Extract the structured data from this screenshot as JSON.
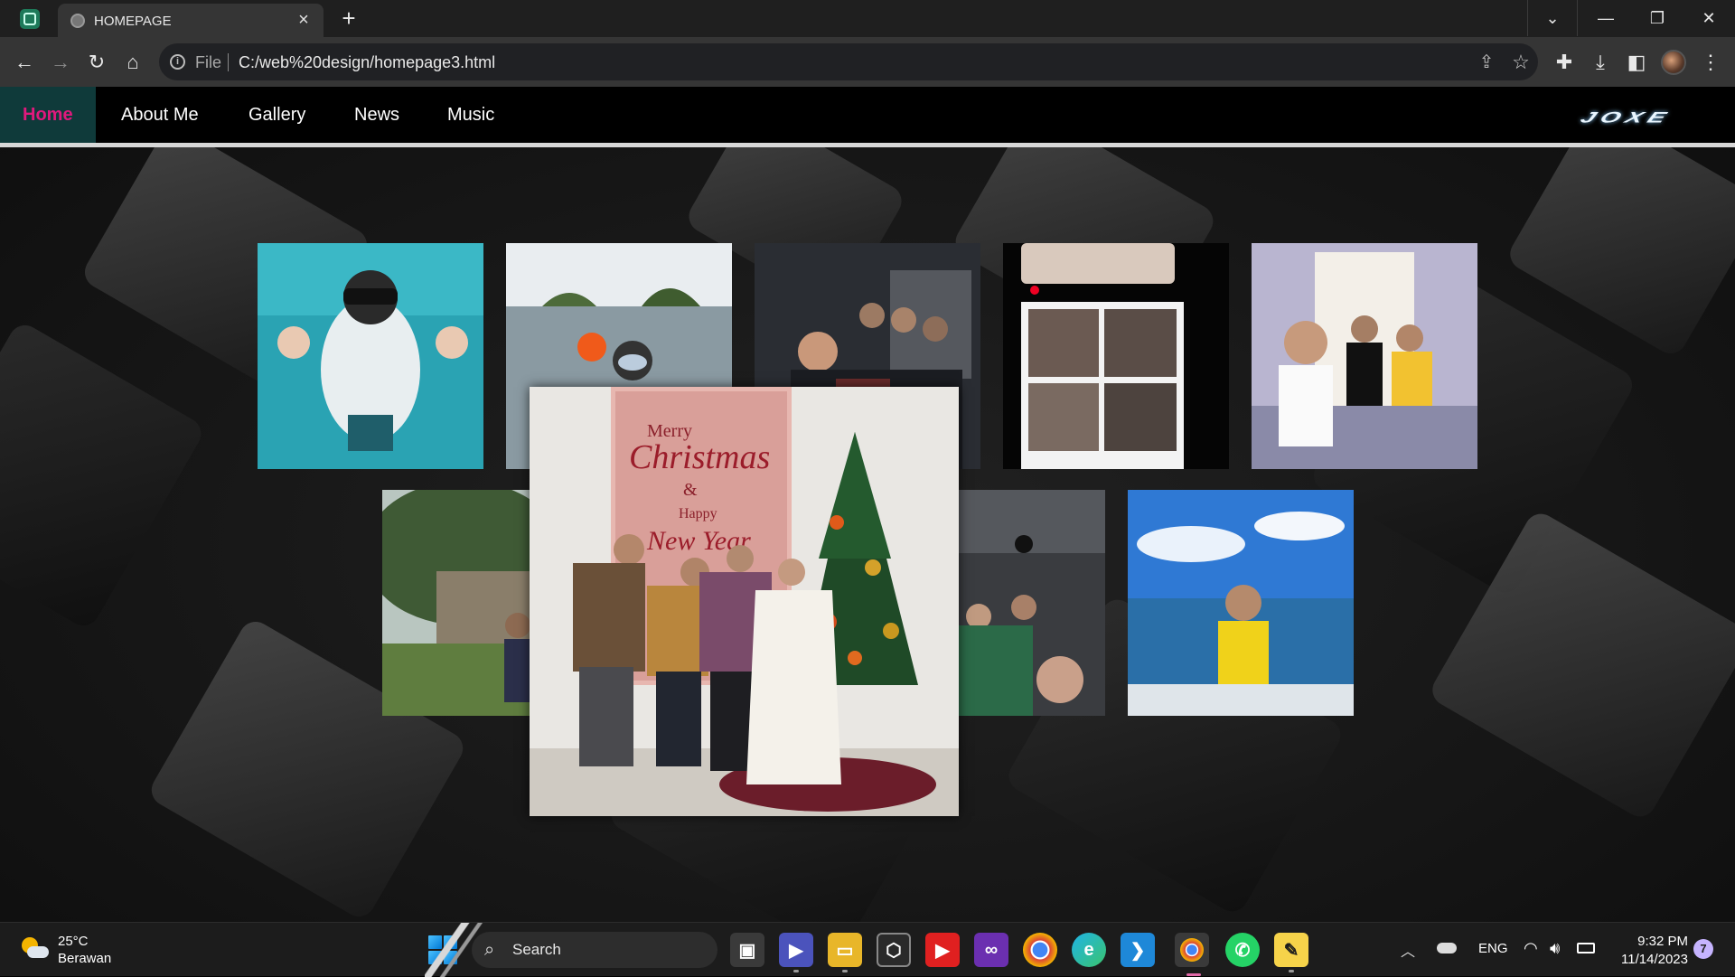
{
  "browser": {
    "tab_title": "HOMEPAGE",
    "scheme_label": "File",
    "url": "C:/web%20design/homepage3.html",
    "window_controls": [
      "chevron-down",
      "minimize",
      "restore",
      "close"
    ]
  },
  "site": {
    "nav": [
      "Home",
      "About Me",
      "Gallery",
      "News",
      "Music"
    ],
    "active_nav": "Home",
    "accent_color": "#e0197d",
    "logo_text": "JOXE"
  },
  "gallery": {
    "photos": [
      {
        "name": "underwater-snorkel-photo"
      },
      {
        "name": "snorkel-island-photo"
      },
      {
        "name": "night-group-photo"
      },
      {
        "name": "photobooth-strip-photo"
      },
      {
        "name": "hallway-friends-photo"
      },
      {
        "name": "campus-tree-photo"
      },
      {
        "name": "party-friends-photo"
      },
      {
        "name": "boat-sea-photo"
      }
    ],
    "featured": {
      "name": "christmas-family-photo",
      "banner_line1": "Merry",
      "banner_line2": "Christmas",
      "banner_line3": "&",
      "banner_line4": "Happy",
      "banner_line5": "New Year"
    }
  },
  "taskbar": {
    "weather_temp": "25°C",
    "weather_desc": "Berawan",
    "search_placeholder": "Search",
    "language": "ENG",
    "time": "9:32 PM",
    "date": "11/14/2023",
    "notification_count": "7",
    "apps": [
      "task-view",
      "teams-meet",
      "file-explorer",
      "github-desktop",
      "youtube",
      "visual-studio",
      "chrome",
      "edge",
      "vscode",
      "chrome-profile",
      "whatsapp",
      "sticky-notes"
    ]
  }
}
